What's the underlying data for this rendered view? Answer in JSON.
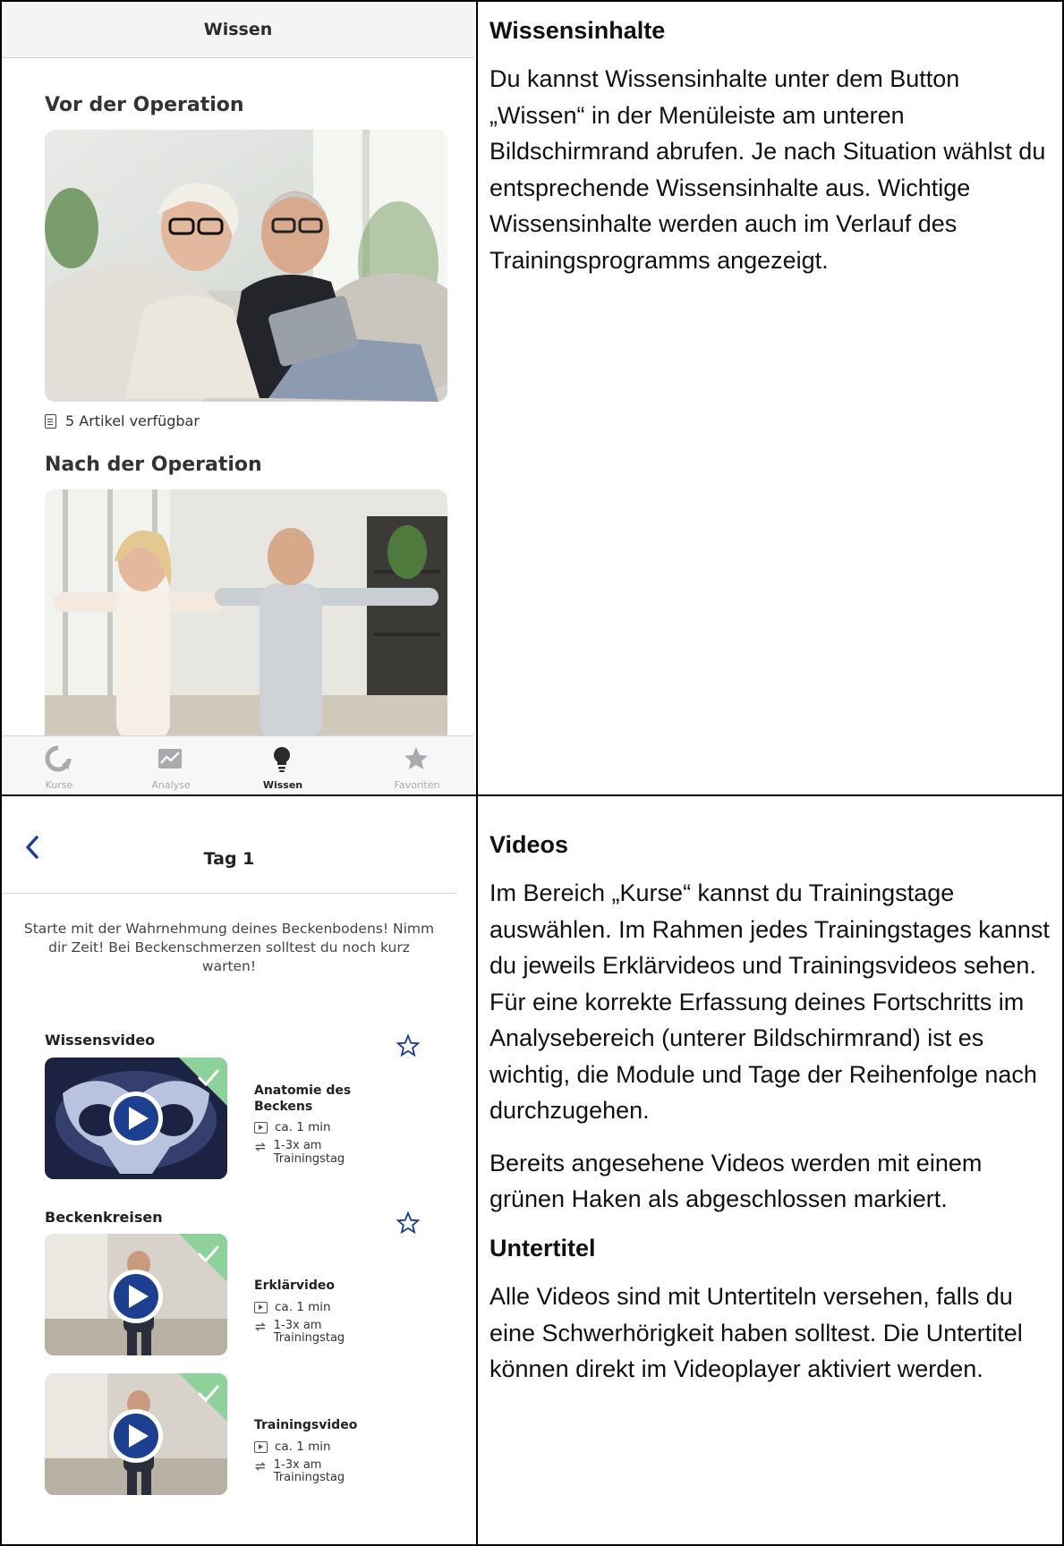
{
  "top_panel": {
    "screen": {
      "header_title": "Wissen",
      "section_before": "Vor der Operation",
      "articles_available": "5 Artikel verfügbar",
      "section_after": "Nach der Operation",
      "tabs": [
        {
          "label": "Kurse",
          "icon": "refresh-icon",
          "active": false
        },
        {
          "label": "Analyse",
          "icon": "chart-icon",
          "active": false
        },
        {
          "label": "Wissen",
          "icon": "lightbulb-icon",
          "active": true
        },
        {
          "label": "Favoriten",
          "icon": "star-icon",
          "active": false
        }
      ]
    },
    "text": {
      "heading": "Wissensinhalte",
      "paragraph": "Du kannst Wissensinhalte unter dem Button „Wissen“ in der Menüleiste am unteren Bildschirmrand abrufen. Je nach Situation wählst du entsprechende Wissensinhalte aus. Wichtige Wissensinhalte werden auch im Verlauf des Trainingsprogramms angezeigt."
    }
  },
  "bottom_panel": {
    "screen": {
      "title": "Tag 1",
      "intro": "Starte mit der Wahrnehmung deines Beckenbodens! Nimm dir Zeit! Bei Beckenschmerzen solltest du noch kurz warten!",
      "groups": [
        {
          "heading": "Wissensvideo",
          "videos": [
            {
              "name": "Anatomie des Beckens",
              "duration": "ca. 1 min",
              "repeat": "1-3x am Trainingstag"
            }
          ]
        },
        {
          "heading": "Beckenkreisen",
          "videos": [
            {
              "name": "Erklärvideo",
              "duration": "ca. 1 min",
              "repeat": "1-3x am Trainingstag"
            },
            {
              "name": "Trainingsvideo",
              "duration": "ca. 1 min",
              "repeat": "1-3x am Trainingstag"
            }
          ]
        }
      ]
    },
    "text": {
      "heading_videos": "Videos",
      "paragraph_1": "Im Bereich „Kurse“ kannst du Trainingstage auswählen. Im Rahmen jedes Trainingstages kannst du jeweils Erklärvideos und Trainingsvideos sehen. Für eine korrekte Erfassung deines Fortschritts im Analysebereich (unterer Bildschirmrand) ist es wichtig, die Module und Tage der Reihenfolge nach durchzugehen.",
      "paragraph_2": "Bereits angesehene Videos werden mit einem grünen Haken als abgeschlossen markiert.",
      "heading_subtitles": "Untertitel",
      "paragraph_3": "Alle Videos sind mit Untertiteln versehen, falls du eine Schwerhörigkeit haben solltest. Die Untertitel können direkt im Videoplayer aktiviert werden."
    }
  },
  "colors": {
    "accent_blue": "#1d3f8f",
    "check_green": "#8ed19a",
    "tab_inactive": "#a9a9ae"
  }
}
